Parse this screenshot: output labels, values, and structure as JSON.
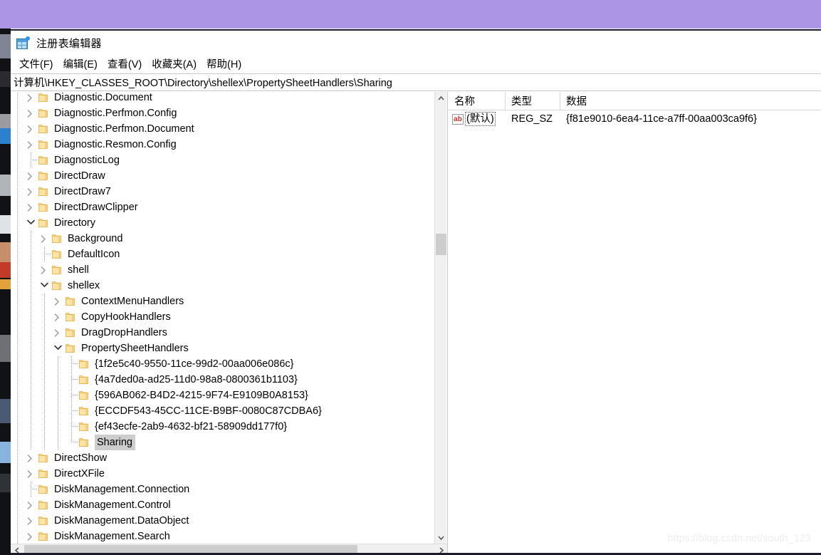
{
  "window": {
    "title": "注册表编辑器",
    "app_icon": "registry-grid-icon"
  },
  "menu": {
    "items": [
      {
        "label": "文件(F)",
        "name": "menu-file"
      },
      {
        "label": "编辑(E)",
        "name": "menu-edit"
      },
      {
        "label": "查看(V)",
        "name": "menu-view"
      },
      {
        "label": "收藏夹(A)",
        "name": "menu-favorites"
      },
      {
        "label": "帮助(H)",
        "name": "menu-help"
      }
    ]
  },
  "address": {
    "path": "计算机\\HKEY_CLASSES_ROOT\\Directory\\shellex\\PropertySheetHandlers\\Sharing"
  },
  "tree": {
    "rows": [
      {
        "label": "Diagnostic.Document",
        "indent": 1,
        "state": "collapsed",
        "selected": false
      },
      {
        "label": "Diagnostic.Perfmon.Config",
        "indent": 1,
        "state": "collapsed",
        "selected": false
      },
      {
        "label": "Diagnostic.Perfmon.Document",
        "indent": 1,
        "state": "collapsed",
        "selected": false
      },
      {
        "label": "Diagnostic.Resmon.Config",
        "indent": 1,
        "state": "collapsed",
        "selected": false
      },
      {
        "label": "DiagnosticLog",
        "indent": 1,
        "state": "leaf",
        "selected": false
      },
      {
        "label": "DirectDraw",
        "indent": 1,
        "state": "collapsed",
        "selected": false
      },
      {
        "label": "DirectDraw7",
        "indent": 1,
        "state": "collapsed",
        "selected": false
      },
      {
        "label": "DirectDrawClipper",
        "indent": 1,
        "state": "collapsed",
        "selected": false
      },
      {
        "label": "Directory",
        "indent": 1,
        "state": "expanded",
        "selected": false
      },
      {
        "label": "Background",
        "indent": 2,
        "state": "collapsed",
        "selected": false
      },
      {
        "label": "DefaultIcon",
        "indent": 2,
        "state": "leaf",
        "selected": false
      },
      {
        "label": "shell",
        "indent": 2,
        "state": "collapsed",
        "selected": false
      },
      {
        "label": "shellex",
        "indent": 2,
        "state": "expanded",
        "selected": false
      },
      {
        "label": "ContextMenuHandlers",
        "indent": 3,
        "state": "collapsed",
        "selected": false
      },
      {
        "label": "CopyHookHandlers",
        "indent": 3,
        "state": "collapsed",
        "selected": false
      },
      {
        "label": "DragDropHandlers",
        "indent": 3,
        "state": "collapsed",
        "selected": false
      },
      {
        "label": "PropertySheetHandlers",
        "indent": 3,
        "state": "expanded",
        "selected": false
      },
      {
        "label": "{1f2e5c40-9550-11ce-99d2-00aa006e086c}",
        "indent": 4,
        "state": "leaf",
        "selected": false
      },
      {
        "label": "{4a7ded0a-ad25-11d0-98a8-0800361b1103}",
        "indent": 4,
        "state": "leaf",
        "selected": false
      },
      {
        "label": "{596AB062-B4D2-4215-9F74-E9109B0A8153}",
        "indent": 4,
        "state": "leaf",
        "selected": false
      },
      {
        "label": "{ECCDF543-45CC-11CE-B9BF-0080C87CDBA6}",
        "indent": 4,
        "state": "leaf",
        "selected": false
      },
      {
        "label": "{ef43ecfe-2ab9-4632-bf21-58909dd177f0}",
        "indent": 4,
        "state": "leaf",
        "selected": false
      },
      {
        "label": "Sharing",
        "indent": 4,
        "state": "leaf",
        "selected": true
      },
      {
        "label": "DirectShow",
        "indent": 1,
        "state": "collapsed",
        "selected": false
      },
      {
        "label": "DirectXFile",
        "indent": 1,
        "state": "collapsed",
        "selected": false
      },
      {
        "label": "DiskManagement.Connection",
        "indent": 1,
        "state": "leaf",
        "selected": false
      },
      {
        "label": "DiskManagement.Control",
        "indent": 1,
        "state": "collapsed",
        "selected": false
      },
      {
        "label": "DiskManagement.DataObject",
        "indent": 1,
        "state": "collapsed",
        "selected": false
      },
      {
        "label": "DiskManagement.Search",
        "indent": 1,
        "state": "collapsed",
        "selected": false
      }
    ]
  },
  "values": {
    "columns": [
      "名称",
      "类型",
      "数据"
    ],
    "rows": [
      {
        "icon": "string-value-icon",
        "name": "(默认)",
        "type": "REG_SZ",
        "data": "{f81e9010-6ea4-11ce-a7ff-00aa003ca9f6}"
      }
    ]
  },
  "watermark": {
    "text": "https://blog.csdn.net/south_123"
  },
  "colors": {
    "desktop_band": "#ab96e6",
    "folder": "#fbd27f",
    "selection": "#cdcdcd",
    "scrollbar_thumb": "#cdcdcd"
  }
}
